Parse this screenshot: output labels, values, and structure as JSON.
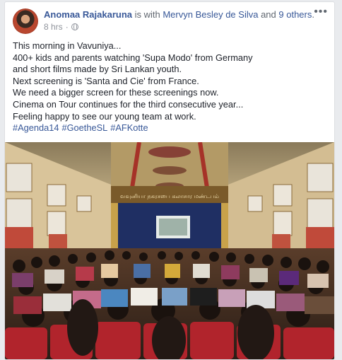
{
  "post": {
    "author": "Anomaa Rajakaruna",
    "with_text": " is with ",
    "tagged_person": "Mervyn Besley de Silva",
    "and_text": " and ",
    "others": "9 others",
    "period": ".",
    "timestamp": "8 hrs",
    "dot": "·",
    "more_icon": "more-dots-icon",
    "privacy_icon": "globe-icon",
    "lines": [
      "This morning in Vavuniya...",
      "400+ kids and parents watching 'Supa Modo' from Germany",
      "and short films made by Sri Lankan youth.",
      "Next screening is 'Santa and Cie' from France.",
      "We need a bigger screen for these screenings now.",
      "Cinema on Tour continues for the third consecutive year...",
      "Feeling happy to see our young team at work."
    ],
    "hashtags": [
      "#Agenda14",
      "#GoetheSL",
      "#AFKotte"
    ]
  },
  "colors": {
    "link": "#385898",
    "text": "#1d2129",
    "meta": "#90949c",
    "hall_wall": "#c9b48a",
    "stage_curtain": "#1f2f63",
    "chairs": "#b1242c"
  },
  "photo": {
    "banner_text": "வவுனியா நகரசபை கலாசார மண்டபம்"
  }
}
